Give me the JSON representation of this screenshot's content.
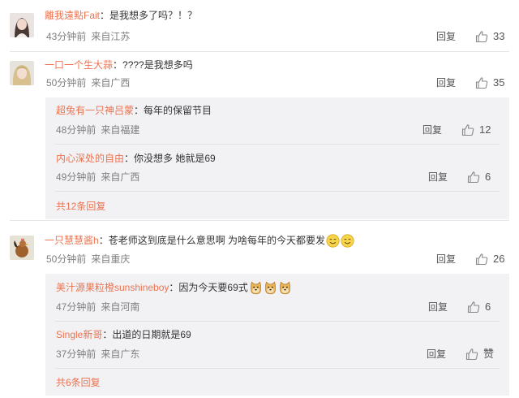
{
  "comments": [
    {
      "username": "離我遠點Fait",
      "text": "是我想多了吗？！？",
      "time": "43分钟前",
      "from": "来自江苏",
      "reply_label": "回复",
      "likes": "33",
      "avatar": "girl-avatar"
    },
    {
      "username": "一口一个生大蒜",
      "text": "????是我想多吗",
      "time": "50分钟前",
      "from": "来自广西",
      "reply_label": "回复",
      "likes": "35",
      "avatar": "blonde-avatar",
      "replies": [
        {
          "username": "超兔有一只神吕蒙",
          "text": "每年的保留节目",
          "time": "48分钟前",
          "from": "来自福建",
          "reply_label": "回复",
          "likes": "12"
        },
        {
          "username": "内心深处的自由",
          "text": "你没想多 她就是69",
          "time": "49分钟前",
          "from": "来自广西",
          "reply_label": "回复",
          "likes": "6"
        }
      ],
      "more_label": "共12条回复"
    },
    {
      "username": "一只慧慧酱h",
      "text": "苍老师这到底是什么意思啊 为啥每年的今天都要发",
      "emoji": "smiley-emoji",
      "time": "50分钟前",
      "from": "来自重庆",
      "reply_label": "回复",
      "likes": "26",
      "avatar": "rooster-avatar",
      "replies": [
        {
          "username": "美汁源果粒橙sunshineboy",
          "text": "因为今天要69式",
          "emoji": "doge-emoji",
          "time": "47分钟前",
          "from": "来自河南",
          "reply_label": "回复",
          "likes": "6"
        },
        {
          "username": "Single新哥",
          "text": "出道的日期就是69",
          "time": "37分钟前",
          "from": "来自广东",
          "reply_label": "回复",
          "likes": "赞"
        }
      ],
      "more_label": "共6条回复"
    }
  ],
  "colors": {
    "username": "#eb7350",
    "meta": "#808080",
    "reply_box": "#f2f2f5"
  }
}
